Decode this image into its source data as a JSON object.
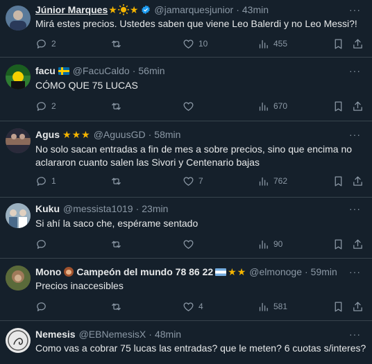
{
  "tweets": [
    {
      "name": "Júnior Marques",
      "stars": [
        "★"
      ],
      "handle": "@jamarquesjunior",
      "time": "43min",
      "text": "Mirá estes precios. Ustedes saben que viene Leo Balerdi y no  Leo Messi?!",
      "reply": "2",
      "retweet": "",
      "like": "10",
      "views": "455",
      "avatar_color": "#5a7a9a"
    },
    {
      "name": "facu",
      "handle": "@FacuCaldo",
      "time": "56min",
      "text": "CÓMO QUE 75 LUCAS",
      "reply": "2",
      "retweet": "",
      "like": "",
      "views": "670",
      "avatar_color": "#2e7d32"
    },
    {
      "name": "Agus",
      "stars": [
        "★",
        "★",
        "★"
      ],
      "handle": "@AguusGD",
      "time": "58min",
      "text": "No solo sacan entradas a fin de mes a sobre precios, sino que encima no aclararon cuanto salen las Sivori y Centenario bajas",
      "reply": "1",
      "retweet": "",
      "like": "7",
      "views": "762",
      "avatar_color": "#4a4a5a"
    },
    {
      "name": "Kuku",
      "handle": "@messista1019",
      "time": "23min",
      "text": "Si ahí la saco che, espérame sentado",
      "reply": "",
      "retweet": "",
      "like": "",
      "views": "90",
      "avatar_color": "#6f7f8f"
    },
    {
      "name": "Mono",
      "name_suffix": "Campeón del mundo 78 86 22",
      "stars": [
        "★",
        "★"
      ],
      "handle": "@elmonoge",
      "time": "59min",
      "text": "Precios inaccesibles",
      "reply": "",
      "retweet": "",
      "like": "4",
      "views": "581",
      "avatar_color": "#7a6a3a"
    },
    {
      "name": "Nemesis",
      "handle": "@EBNemesisX",
      "time": "48min",
      "text": "Como vas a cobrar 75 lucas las entradas? que le meten? 6 cuotas s/interes?",
      "avatar_color": "#d8d8d8"
    }
  ],
  "separator": "·",
  "more": "···",
  "colors": {
    "background": "#15202b",
    "text": "#e7e9ea",
    "muted": "#8b98a5",
    "star": "#f4b400",
    "verified": "#1d9bf0"
  },
  "icons": [
    "reply-icon",
    "retweet-icon",
    "like-icon",
    "views-icon",
    "bookmark-icon",
    "share-icon",
    "verified-icon",
    "more-icon",
    "sun-icon"
  ]
}
